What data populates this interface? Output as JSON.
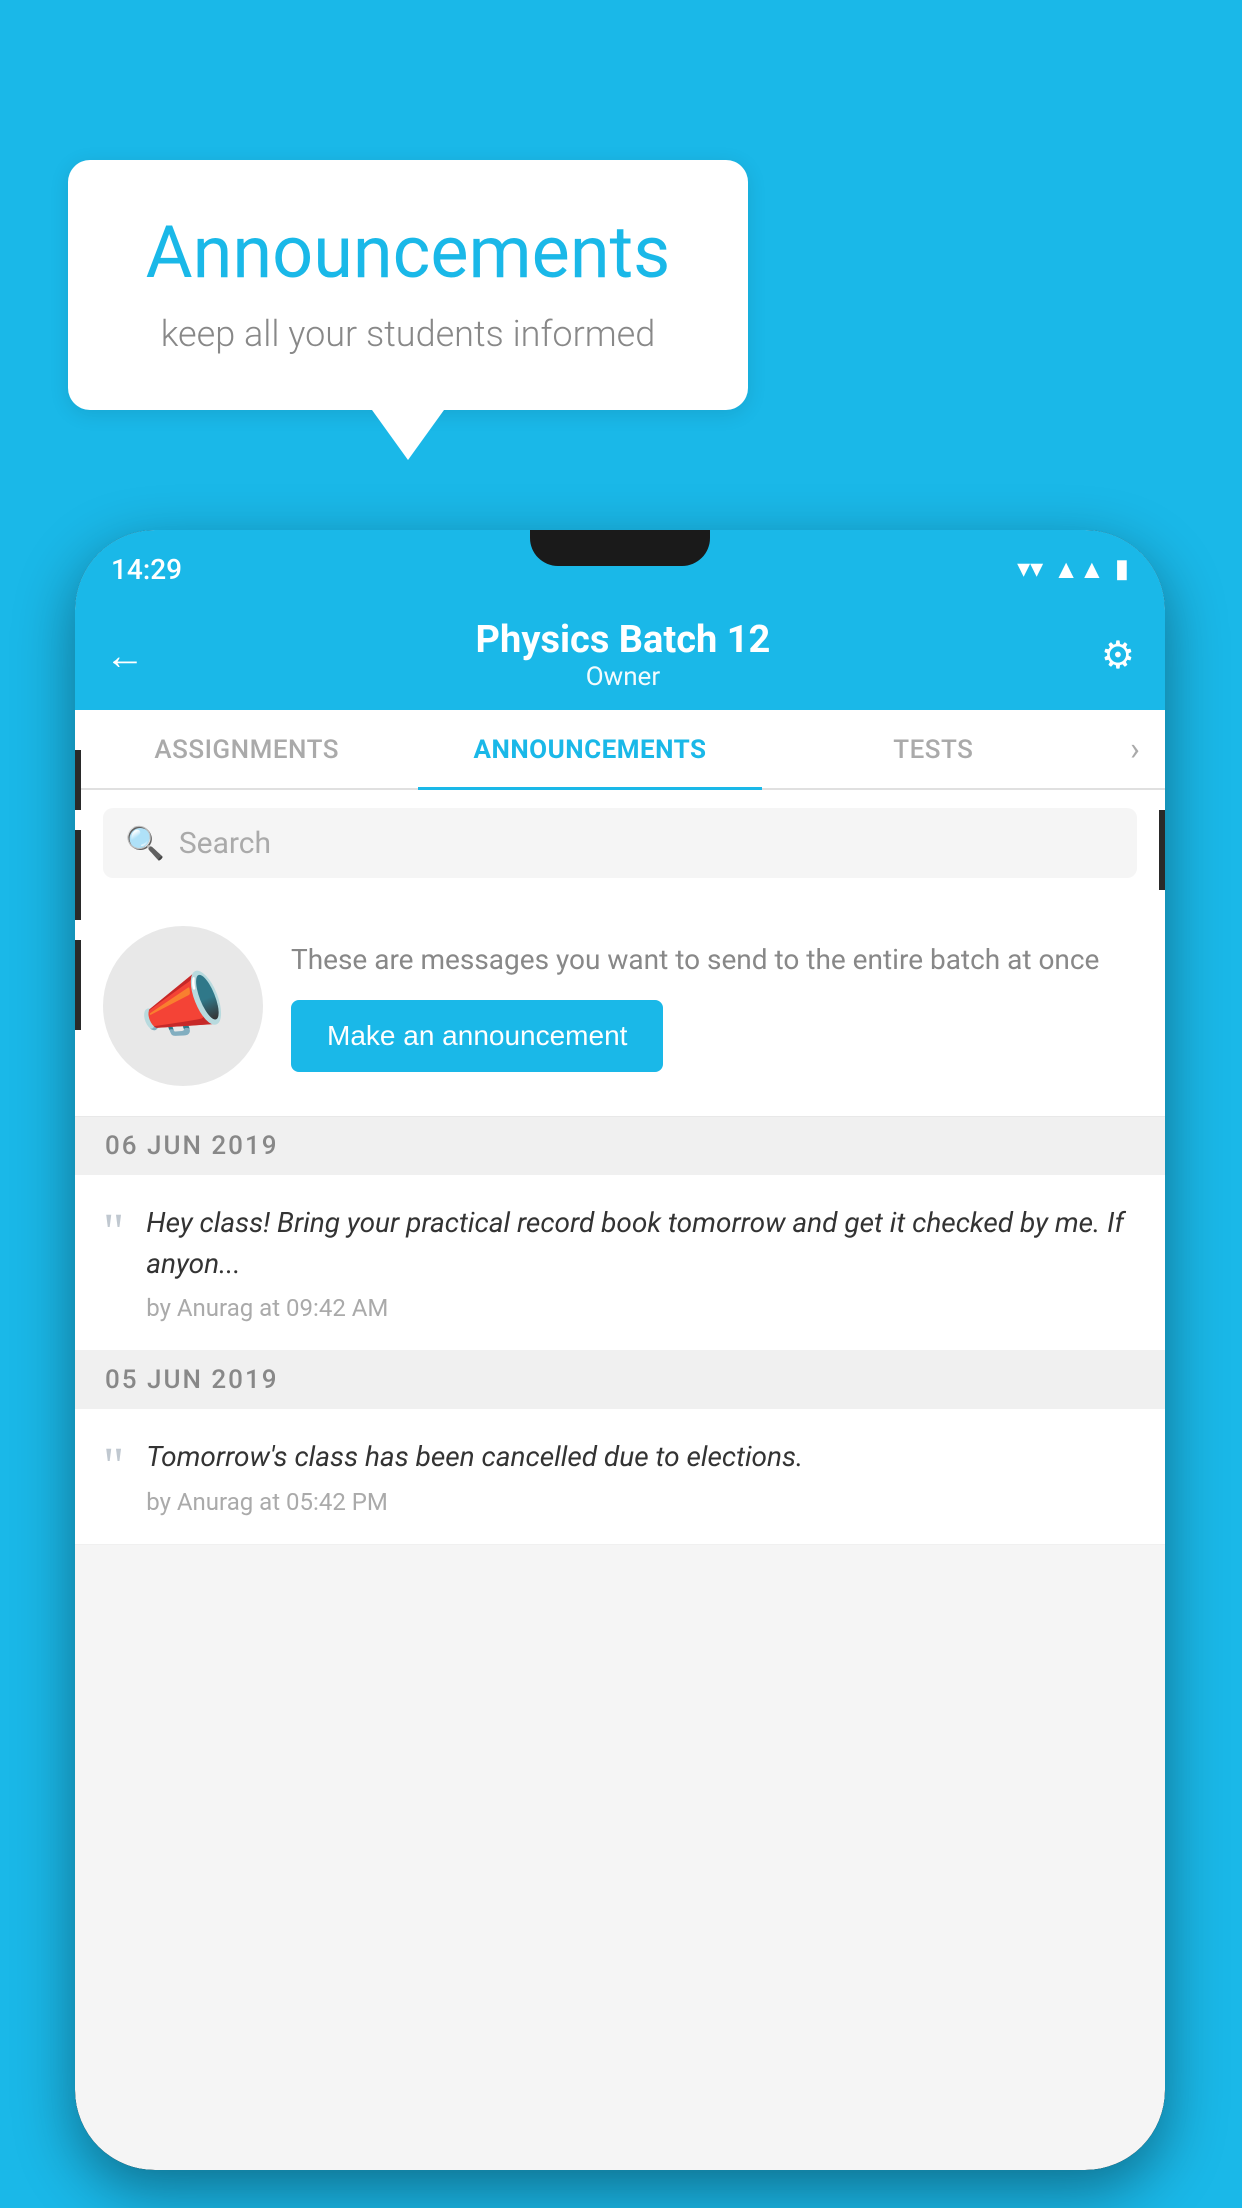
{
  "background_color": "#1ab8e8",
  "speech_bubble": {
    "title": "Announcements",
    "subtitle": "keep all your students informed"
  },
  "phone": {
    "status_bar": {
      "time": "14:29",
      "icons": [
        "wifi",
        "signal",
        "battery"
      ]
    },
    "header": {
      "title": "Physics Batch 12",
      "subtitle": "Owner",
      "back_label": "←",
      "gear_label": "⚙"
    },
    "tabs": [
      {
        "label": "ASSIGNMENTS",
        "active": false
      },
      {
        "label": "ANNOUNCEMENTS",
        "active": true
      },
      {
        "label": "TESTS",
        "active": false
      }
    ],
    "search": {
      "placeholder": "Search"
    },
    "announce_prompt": {
      "description": "These are messages you want to send to the entire batch at once",
      "button_label": "Make an announcement"
    },
    "announcements": [
      {
        "date": "06  JUN  2019",
        "text": "Hey class! Bring your practical record book tomorrow and get it checked by me. If anyon...",
        "by": "by Anurag at 09:42 AM"
      },
      {
        "date": "05  JUN  2019",
        "text": "Tomorrow's class has been cancelled due to elections.",
        "by": "by Anurag at 05:42 PM"
      }
    ]
  }
}
